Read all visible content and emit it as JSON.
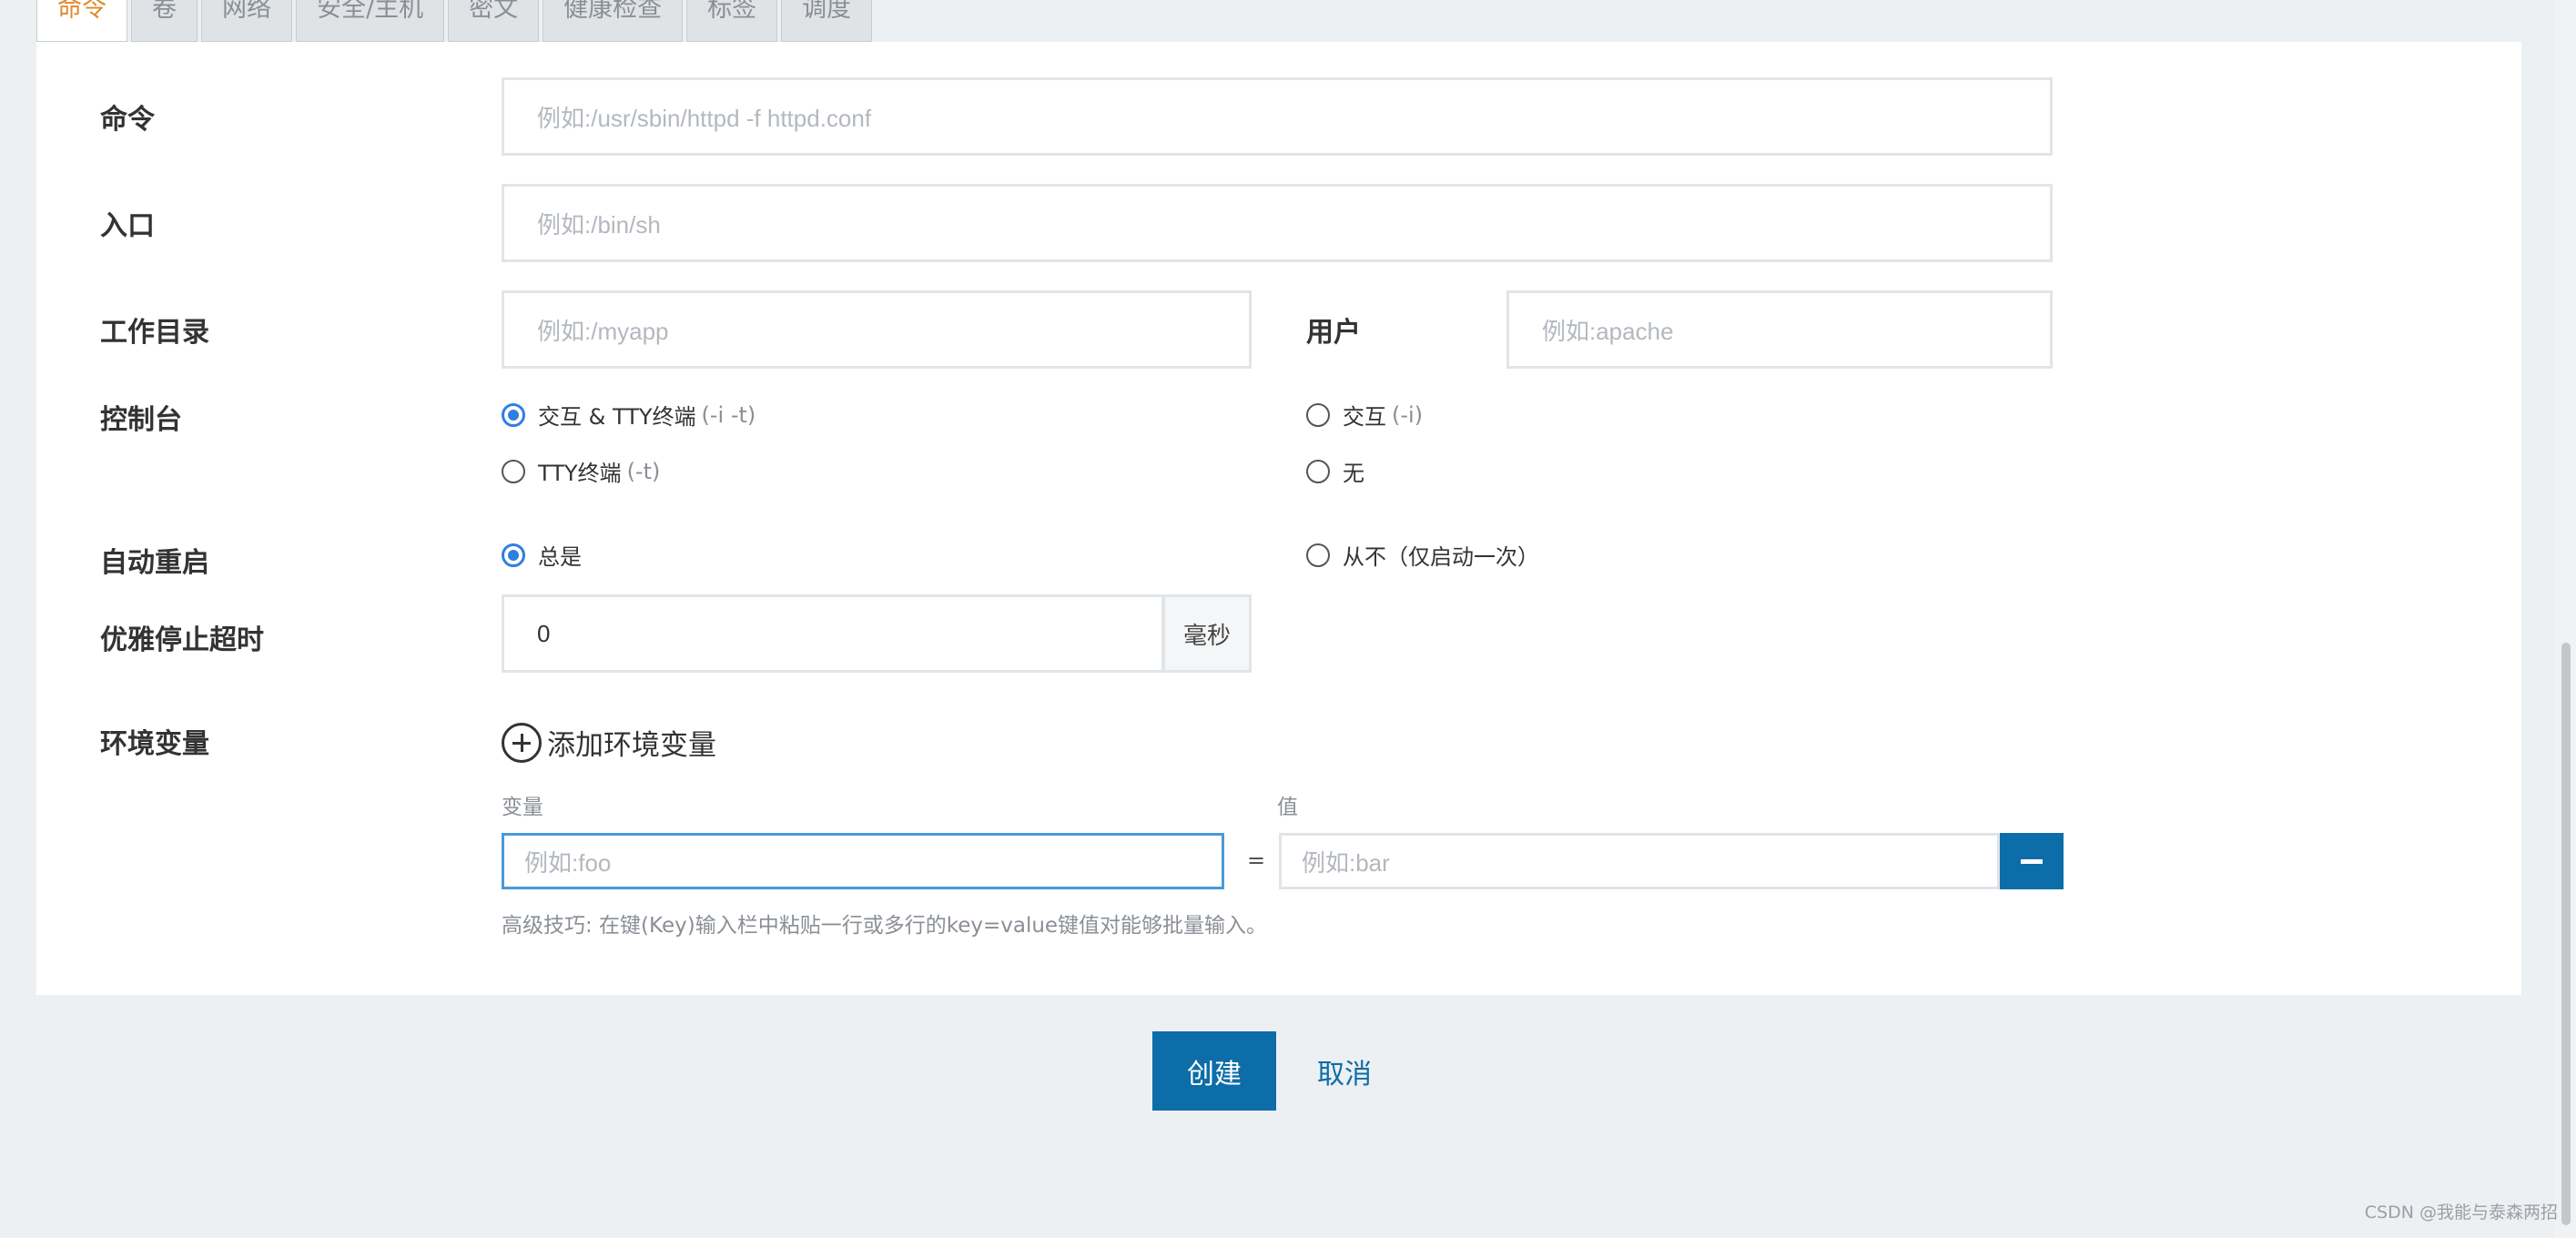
{
  "tabs": [
    "命令",
    "卷",
    "网络",
    "安全/主机",
    "密文",
    "健康检查",
    "标签",
    "调度"
  ],
  "form": {
    "command": {
      "label": "命令",
      "placeholder": "例如:/usr/sbin/httpd -f httpd.conf"
    },
    "entrypoint": {
      "label": "入口",
      "placeholder": "例如:/bin/sh"
    },
    "workdir": {
      "label": "工作目录",
      "placeholder": "例如:/myapp"
    },
    "user": {
      "label": "用户",
      "placeholder": "例如:apache"
    },
    "console": {
      "label": "控制台",
      "options": [
        {
          "text": "交互 & TTY终端",
          "hint": "(-i -t)",
          "selected": true
        },
        {
          "text": "交互",
          "hint": "(-i)",
          "selected": false
        },
        {
          "text": "TTY终端",
          "hint": "(-t)",
          "selected": false
        },
        {
          "text": "无",
          "hint": "",
          "selected": false
        }
      ]
    },
    "restart": {
      "label": "自动重启",
      "options": [
        {
          "text": "总是",
          "selected": true
        },
        {
          "text": "从不（仅启动一次）",
          "selected": false
        }
      ]
    },
    "graceful_stop": {
      "label": "优雅停止超时",
      "value": "0",
      "unit": "毫秒"
    },
    "env": {
      "label": "环境变量",
      "add_label": "添加环境变量",
      "key_header": "变量",
      "value_header": "值",
      "key_placeholder": "例如:foo",
      "equals": "=",
      "value_placeholder": "例如:bar",
      "tip": "高级技巧: 在键(Key)输入栏中粘贴一行或多行的key=value键值对能够批量输入。"
    }
  },
  "actions": {
    "create": "创建",
    "cancel": "取消"
  },
  "watermark": "CSDN @我能与泰森两招",
  "colors": {
    "primary": "#0d6da8",
    "radio_selected": "#2f7fe0",
    "active_tab": "#e08a2c"
  }
}
